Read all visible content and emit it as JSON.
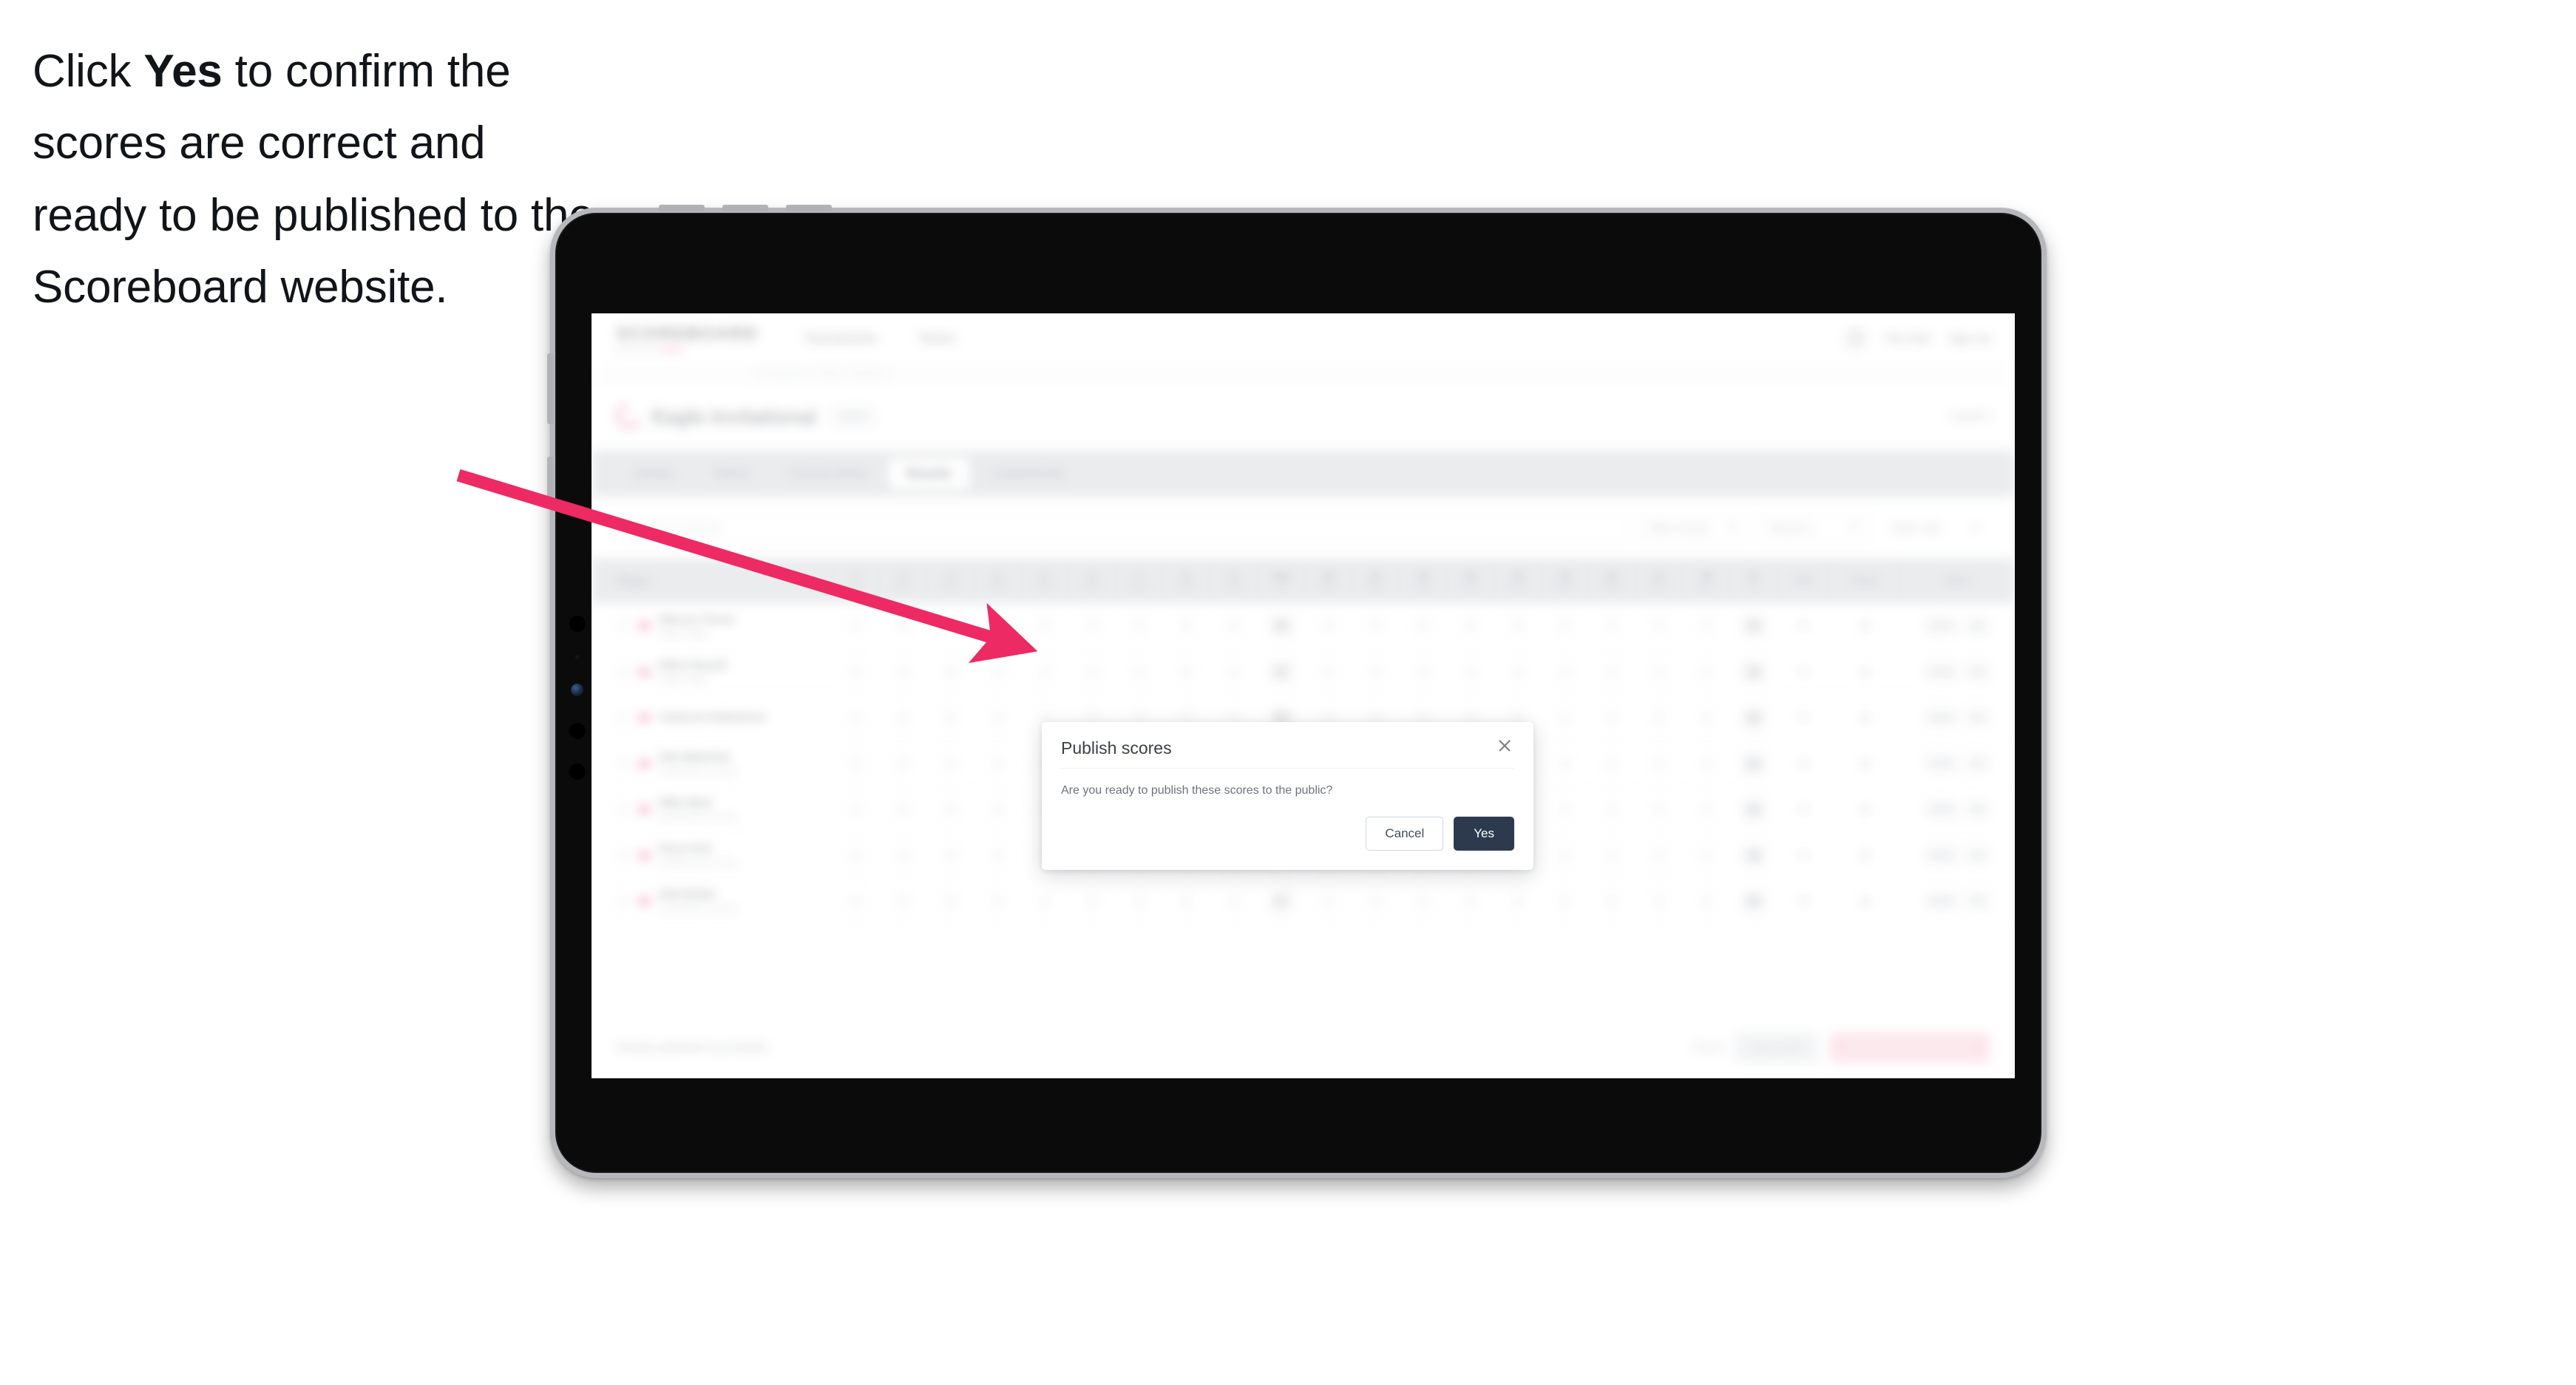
{
  "caption": {
    "line_prefix": "Click ",
    "bold_word": "Yes",
    "rest": " to confirm the scores are correct and ready to be published to the Scoreboard website."
  },
  "annotation": {
    "arrow_color": "#ED2A63",
    "arrow_name": "pointer-arrow"
  },
  "device": {
    "type": "tablet",
    "bezel_color": "#0B0B0C",
    "frame_color": "#B6B8BB"
  },
  "app": {
    "brand": {
      "name": "SCOREBOARD",
      "subtitle": "powered by",
      "subtitle_highlight": "GOLF"
    },
    "topnav": [
      {
        "label": "Tournaments"
      },
      {
        "label": "Teams"
      }
    ],
    "topnav_right": {
      "avatar_icon": "user-avatar-icon",
      "links": [
        {
          "label": "The Club"
        },
        {
          "label": "Sign out"
        }
      ]
    },
    "breadcrumb": "Tournaments / Eagle Invitational",
    "event": {
      "flag_icon": "golf-flag-icon",
      "title": "Eagle Invitational",
      "chip": "2024",
      "right_label": "Level 4"
    },
    "tabs": [
      {
        "label": "Details",
        "active": false
      },
      {
        "label": "Teams",
        "active": false
      },
      {
        "label": "Course Setup",
        "active": false
      },
      {
        "label": "Results",
        "active": true
      },
      {
        "label": "Leaderboard",
        "active": false
      }
    ],
    "filters": {
      "search_icon": "search-icon",
      "search_placeholder": "Search players",
      "filter_buttons": [
        {
          "label": "Filter scores",
          "caret": true
        },
        {
          "label": "Round 1",
          "caret": true
        },
        {
          "label": "Team only",
          "caret": true
        }
      ]
    },
    "table": {
      "columns": {
        "player": "Player",
        "holes": [
          {
            "n": "1",
            "p": "Par 4"
          },
          {
            "n": "2",
            "p": "Par 3"
          },
          {
            "n": "3",
            "p": "Par 5"
          },
          {
            "n": "4",
            "p": "Par 4"
          },
          {
            "n": "5",
            "p": "Par 4"
          },
          {
            "n": "6",
            "p": "Par 3"
          },
          {
            "n": "7",
            "p": "Par 4"
          },
          {
            "n": "8",
            "p": "Par 5"
          },
          {
            "n": "9",
            "p": "Par 4"
          },
          {
            "n": "Out",
            "p": "36"
          },
          {
            "n": "10",
            "p": "Par 4"
          },
          {
            "n": "11",
            "p": "Par 3"
          },
          {
            "n": "12",
            "p": "Par 5"
          },
          {
            "n": "13",
            "p": "Par 4"
          },
          {
            "n": "14",
            "p": "Par 4"
          },
          {
            "n": "15",
            "p": "Par 3"
          },
          {
            "n": "16",
            "p": "Par 4"
          },
          {
            "n": "17",
            "p": "Par 5"
          },
          {
            "n": "18",
            "p": "Par 4"
          },
          {
            "n": "In",
            "p": "36"
          }
        ],
        "total": "Total",
        "played": "Played",
        "status": "Status"
      },
      "rows": [
        {
          "name": "Marcus Torres",
          "club": "Eagle Ridge",
          "front": [
            "4",
            "3",
            "5",
            "4",
            "4",
            "3",
            "4",
            "5",
            "4"
          ],
          "out": "36",
          "back": [
            "4",
            "3",
            "5",
            "4",
            "4",
            "3",
            "4",
            "5",
            "4"
          ],
          "in": "36",
          "total": "72",
          "played": "18",
          "pair": [
            "100%",
            "OK"
          ]
        },
        {
          "name": "Ellen Parnell",
          "club": "Eagle Ridge",
          "front": [
            "5",
            "3",
            "5",
            "4",
            "4",
            "3",
            "4",
            "5",
            "4"
          ],
          "out": "37",
          "back": [
            "4",
            "3",
            "5",
            "4",
            "4",
            "3",
            "4",
            "5",
            "4"
          ],
          "in": "36",
          "total": "73",
          "played": "18",
          "pair": [
            "100%",
            "OK"
          ]
        },
        {
          "name": "Cameron Robertson",
          "club": "",
          "front": [
            "4",
            "3",
            "5",
            "4",
            "4",
            "3",
            "4",
            "5",
            "4"
          ],
          "out": "36",
          "back": [
            "4",
            "3",
            "5",
            "4",
            "4",
            "3",
            "4",
            "5",
            "4"
          ],
          "in": "36",
          "total": "72",
          "played": "18",
          "pair": [
            "100%",
            "OK"
          ]
        },
        {
          "name": "Dan Bateman",
          "club": "Southwood Country",
          "front": [
            "4",
            "4",
            "5",
            "4",
            "4",
            "3",
            "4",
            "5",
            "4"
          ],
          "out": "37",
          "back": [
            "4",
            "3",
            "5",
            "4",
            "4",
            "3",
            "4",
            "5",
            "4"
          ],
          "in": "36",
          "total": "73",
          "played": "18",
          "pair": [
            "100%",
            "OK"
          ]
        },
        {
          "name": "Mike Bant",
          "club": "Southwood Country",
          "front": [
            "4",
            "3",
            "5",
            "4",
            "4",
            "3",
            "4",
            "5",
            "4"
          ],
          "out": "36",
          "back": [
            "4",
            "3",
            "5",
            "4",
            "4",
            "3",
            "4",
            "5",
            "4"
          ],
          "in": "36",
          "total": "72",
          "played": "18",
          "pair": [
            "100%",
            "OK"
          ]
        },
        {
          "name": "Ross Kirk",
          "club": "Southwood Country",
          "front": [
            "4",
            "3",
            "5",
            "4",
            "4",
            "3",
            "4",
            "5",
            "4"
          ],
          "out": "36",
          "back": [
            "4",
            "3",
            "5",
            "4",
            "4",
            "3",
            "4",
            "5",
            "4"
          ],
          "in": "36",
          "total": "72",
          "played": "18",
          "pair": [
            "100%",
            "OK"
          ]
        },
        {
          "name": "Rob Butler",
          "club": "Southwood Country",
          "front": [
            "5",
            "3",
            "5",
            "4",
            "4",
            "3",
            "4",
            "5",
            "4"
          ],
          "out": "37",
          "back": [
            "4",
            "3",
            "5",
            "4",
            "4",
            "3",
            "4",
            "5",
            "4"
          ],
          "in": "36",
          "total": "73",
          "played": "18",
          "pair": [
            "100%",
            "OK"
          ]
        }
      ]
    },
    "bottombar": {
      "message": "Results published successfully",
      "link_label": "Reset",
      "secondary_label": "Save draft",
      "primary_label": "Publish to Scoreboard"
    }
  },
  "modal": {
    "title": "Publish scores",
    "close_icon": "close-icon",
    "body": "Are you ready to publish these scores to the public?",
    "cancel_label": "Cancel",
    "confirm_label": "Yes",
    "confirm_color": "#2D3A4E"
  }
}
